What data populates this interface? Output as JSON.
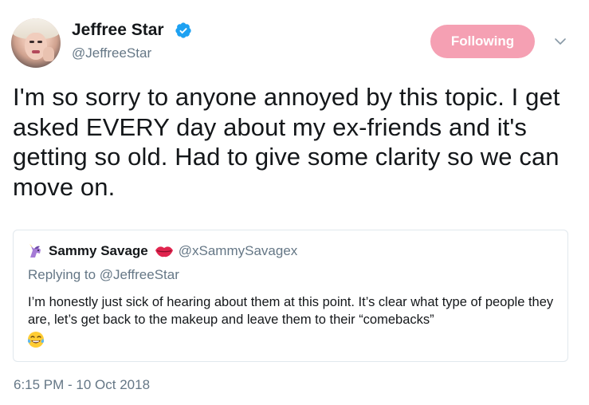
{
  "author": {
    "display_name": "Jeffree Star",
    "handle": "@JeffreeStar",
    "verified": true,
    "avatar_icon": "profile-photo"
  },
  "follow_button": {
    "label": "Following",
    "color": "#f5a0b3"
  },
  "menu_icon": "chevron-down-icon",
  "tweet": {
    "text": "I'm so sorry to anyone annoyed by this topic. I get asked EVERY day about my ex-friends and it's getting so old. Had to give some clarity so we can move on.",
    "timestamp": "6:15 PM - 10 Oct 2018"
  },
  "quoted_tweet": {
    "name_emoji_icon": "unicorn-icon",
    "display_name": "Sammy Savage",
    "handle_emoji_icon": "lips-icon",
    "handle": "@xSammySavagex",
    "replying_label": "Replying to",
    "replying_to": "@JeffreeStar",
    "text": "I’m honestly just sick of hearing about them at this point. It’s clear what type of people they are, let’s get back to the makeup and leave them to their “comebacks”",
    "trailing_emoji_icon": "tears-of-joy-icon"
  },
  "colors": {
    "secondary_text": "#657786",
    "primary_text": "#14171a",
    "verified_blue": "#1da1f2",
    "card_border": "#e1e8ed"
  }
}
